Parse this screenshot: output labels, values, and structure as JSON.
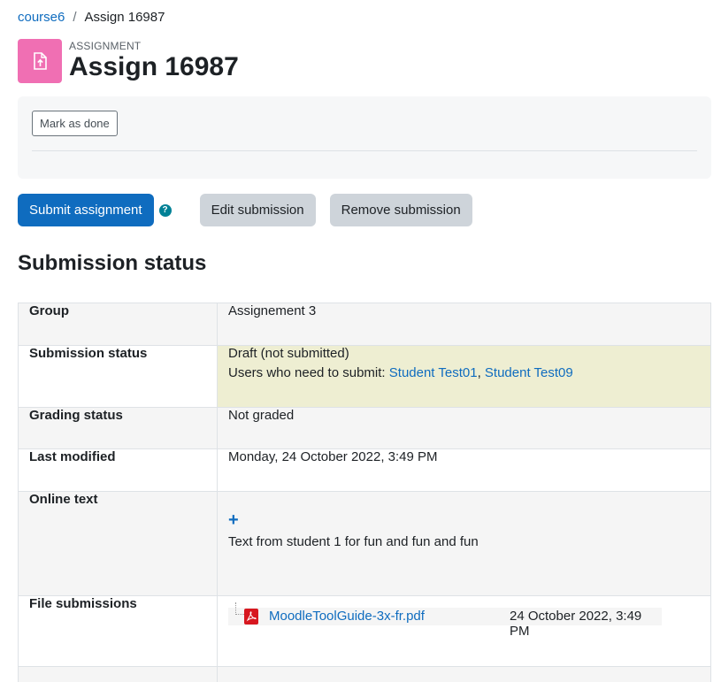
{
  "breadcrumb": {
    "course": "course6",
    "separator": "/",
    "current": "Assign 16987"
  },
  "header": {
    "pre_title": "ASSIGNMENT",
    "title": "Assign 16987",
    "icon": "assignment-upload-icon",
    "icon_color": "#f06fb3"
  },
  "activity": {
    "mark_done_label": "Mark as done"
  },
  "actions": {
    "submit_label": "Submit assignment",
    "help_glyph": "?",
    "edit_label": "Edit submission",
    "remove_label": "Remove submission"
  },
  "section_title": "Submission status",
  "status_table": {
    "group": {
      "label": "Group",
      "value": "Assignement 3"
    },
    "submission_status": {
      "label": "Submission status",
      "value": "Draft (not submitted)",
      "users_prefix": "Users who need to submit: ",
      "user1": "Student Test01",
      "comma": ", ",
      "user2": "Student Test09"
    },
    "grading_status": {
      "label": "Grading status",
      "value": "Not graded"
    },
    "last_modified": {
      "label": "Last modified",
      "value": "Monday, 24 October 2022, 3:49 PM"
    },
    "online_text": {
      "label": "Online text",
      "expand_glyph": "+",
      "value": "Text from student 1 for fun and fun and fun"
    },
    "file_submissions": {
      "label": "File submissions",
      "file_name": "MoodleToolGuide-3x-fr.pdf",
      "file_date": "24 October 2022, 3:49 PM"
    }
  },
  "colors": {
    "primary": "#0f6cbf",
    "secondary": "#ced4da",
    "draft_bg": "#eeeed2",
    "help": "#008196",
    "pdf": "#d7171f"
  }
}
